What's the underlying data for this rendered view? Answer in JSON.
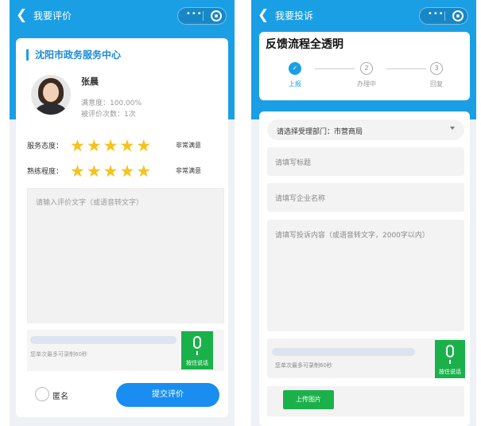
{
  "left": {
    "nav_title": "我要评价",
    "org_name": "沈阳市政务服务中心",
    "staff": {
      "name": "张晨",
      "satisfaction": "满意度：100.00%",
      "rated_count": "被评价次数：1次"
    },
    "ratings": [
      {
        "label": "服务态度：",
        "stars": 5,
        "text": "非常满意"
      },
      {
        "label": "熟练程度：",
        "stars": 5,
        "text": "非常满意"
      }
    ],
    "comment_placeholder": "请输入评价文字（或语音转文字）",
    "voice_hint": "您单次最多可录制60秒",
    "voice_button_label": "按住说话",
    "anonymous_label": "匿名",
    "submit_label": "提交评价"
  },
  "right": {
    "nav_title": "我要投诉",
    "flow_title": "反馈流程全透明",
    "steps": [
      {
        "num": "✓",
        "label": "上报",
        "active": true
      },
      {
        "num": "2",
        "label": "办理中",
        "active": false
      },
      {
        "num": "3",
        "label": "回复",
        "active": false
      }
    ],
    "dept_select": "请选择受理部门：市营商局",
    "title_placeholder": "请填写标题",
    "company_placeholder": "请填写企业名称",
    "content_placeholder": "请填写投诉内容（或语音转文字，2000字以内）",
    "voice_hint": "您单次最多可录制60秒",
    "voice_button_label": "按住说话",
    "upload_label": "上传图片"
  },
  "icons": {
    "back": "chevron-left-icon",
    "more": "more-dots-icon",
    "record": "record-icon",
    "star": "star-icon",
    "mic": "microphone-icon"
  },
  "colors": {
    "header_blue": "#1a9fe5",
    "star_yellow": "#f6c21d",
    "voice_green": "#1bb14a",
    "submit_blue": "#1a8ef0"
  }
}
